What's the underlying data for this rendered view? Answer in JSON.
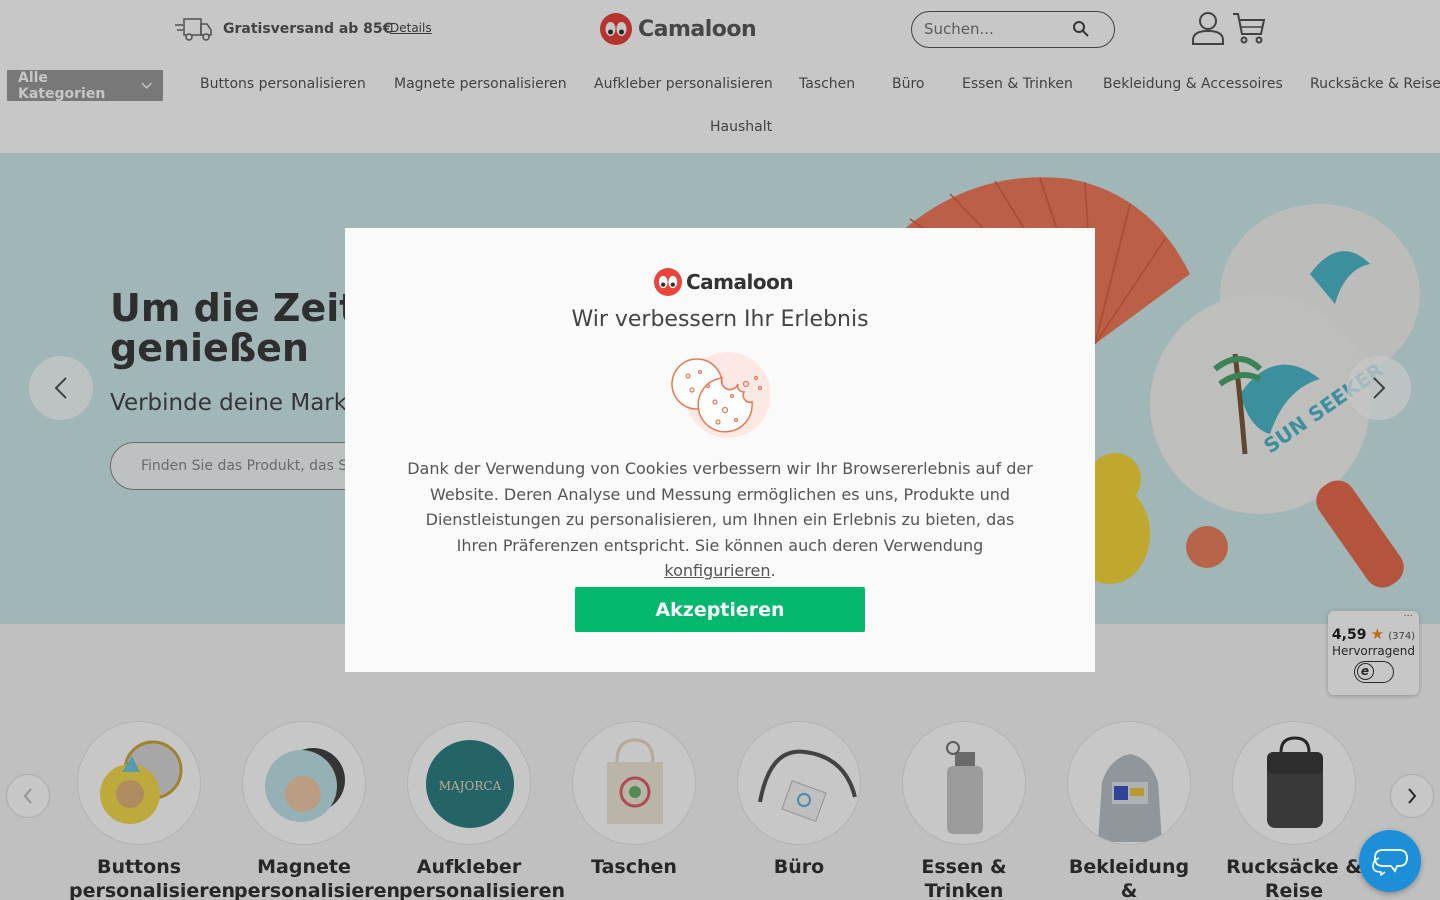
{
  "header": {
    "shipping_text": "Gratisversand ab 85€",
    "shipping_link": "Details",
    "logo_text": "Camaloon",
    "search_placeholder": "Suchen..."
  },
  "nav": {
    "all_categories": "Alle Kategorien",
    "items": [
      "Buttons personalisieren",
      "Magnete personalisieren",
      "Aufkleber personalisieren",
      "Taschen",
      "Büro",
      "Essen & Trinken",
      "Bekleidung & Accessoires",
      "Rucksäcke & Reise",
      "Haushalt"
    ]
  },
  "hero": {
    "title_line1": "Um die Zeit in",
    "title_line2": "genießen",
    "subtitle": "Verbinde deine Marke",
    "search_placeholder": "Finden Sie das Produkt, das S"
  },
  "categories": [
    {
      "label_line1": "Buttons",
      "label_line2": "personalisieren"
    },
    {
      "label_line1": "Magnete",
      "label_line2": "personalisieren"
    },
    {
      "label_line1": "Aufkleber",
      "label_line2": "personalisieren"
    },
    {
      "label_line1": "Taschen",
      "label_line2": ""
    },
    {
      "label_line1": "Büro",
      "label_line2": ""
    },
    {
      "label_line1": "Essen &",
      "label_line2": "Trinken"
    },
    {
      "label_line1": "Bekleidung",
      "label_line2": "&"
    },
    {
      "label_line1": "Rucksäcke &",
      "label_line2": "Reise"
    }
  ],
  "rating": {
    "score": "4,59",
    "count": "(374)",
    "label": "Hervorragend",
    "badge": "e",
    "menu": "···"
  },
  "modal": {
    "logo_text": "Camaloon",
    "title": "Wir verbessern Ihr Erlebnis",
    "body_text": "Dank der Verwendung von Cookies verbessern wir Ihr Browsererlebnis auf der Website. Deren Analyse und Messung ermöglichen es uns, Produkte und Dienstleistungen zu personalisieren, um Ihnen ein Erlebnis zu bieten, das Ihren Präferenzen entspricht. Sie können auch deren Verwendung",
    "configure_link": "konfigurieren",
    "body_end": ".",
    "accept_label": "Akzeptieren"
  },
  "colors": {
    "accent_green": "#04b86e",
    "brand_red": "#e8453c",
    "hero_bg": "#cfe9e9",
    "chat_blue": "#1c8fd8"
  }
}
